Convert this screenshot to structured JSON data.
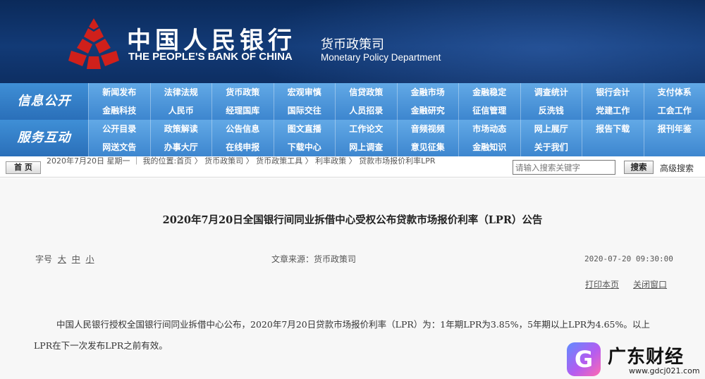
{
  "colors": {
    "header_bg": "#0d2e62",
    "nav_bg": "#3d86cf",
    "logo_red": "#d0201b"
  },
  "header": {
    "bank_name_cn": "中国人民银行",
    "bank_name_en": "THE PEOPLE'S BANK OF CHINA",
    "dept_cn": "货币政策司",
    "dept_en": "Monetary Policy Department",
    "logo_icon": "pboc-logo-icon"
  },
  "nav": {
    "section1_label": "信息公开",
    "section1_items": [
      "新闻发布",
      "法律法规",
      "货币政策",
      "宏观审慎",
      "信贷政策",
      "金融市场",
      "金融稳定",
      "调查统计",
      "银行会计",
      "支付体系",
      "金融科技",
      "人民币",
      "经理国库",
      "国际交往",
      "人员招录",
      "金融研究",
      "征信管理",
      "反洗钱",
      "党建工作",
      "工会工作"
    ],
    "section2_label": "服务互动",
    "section2_items": [
      "公开目录",
      "政策解读",
      "公告信息",
      "图文直播",
      "工作论文",
      "音频视频",
      "市场动态",
      "网上展厅",
      "报告下载",
      "报刊年鉴",
      "网送文告",
      "办事大厅",
      "在线申报",
      "下载中心",
      "网上调查",
      "意见征集",
      "金融知识",
      "关于我们",
      "",
      ""
    ]
  },
  "toolbar": {
    "home_label": "首 页",
    "breadcrumb": "2020年7月20日 星期一 ｜ 我的位置:首页 〉 货币政策司 〉 货币政策工具 〉 利率政策 〉 贷款市场报价利率LPR",
    "search_placeholder": "请输入搜索关键字",
    "search_label": "搜索",
    "advanced_search_label": "高级搜索"
  },
  "article": {
    "title": "2020年7月20日全国银行间同业拆借中心受权公布贷款市场报价利率（LPR）公告",
    "font_size_label": "字号",
    "font_large": "大",
    "font_medium": "中",
    "font_small": "小",
    "source": "文章来源：货币政策司",
    "date": "2020-07-20 09:30:00",
    "print_label": "打印本页",
    "close_label": "关闭窗口",
    "body": "中国人民银行授权全国银行间同业拆借中心公布，2020年7月20日贷款市场报价利率（LPR）为：1年期LPR为3.85%，5年期以上LPR为4.65%。以上LPR在下一次发布LPR之前有效。"
  },
  "watermark": {
    "badge_letter": "G",
    "name": "广东财经",
    "url": "www.gdcj021.com"
  }
}
